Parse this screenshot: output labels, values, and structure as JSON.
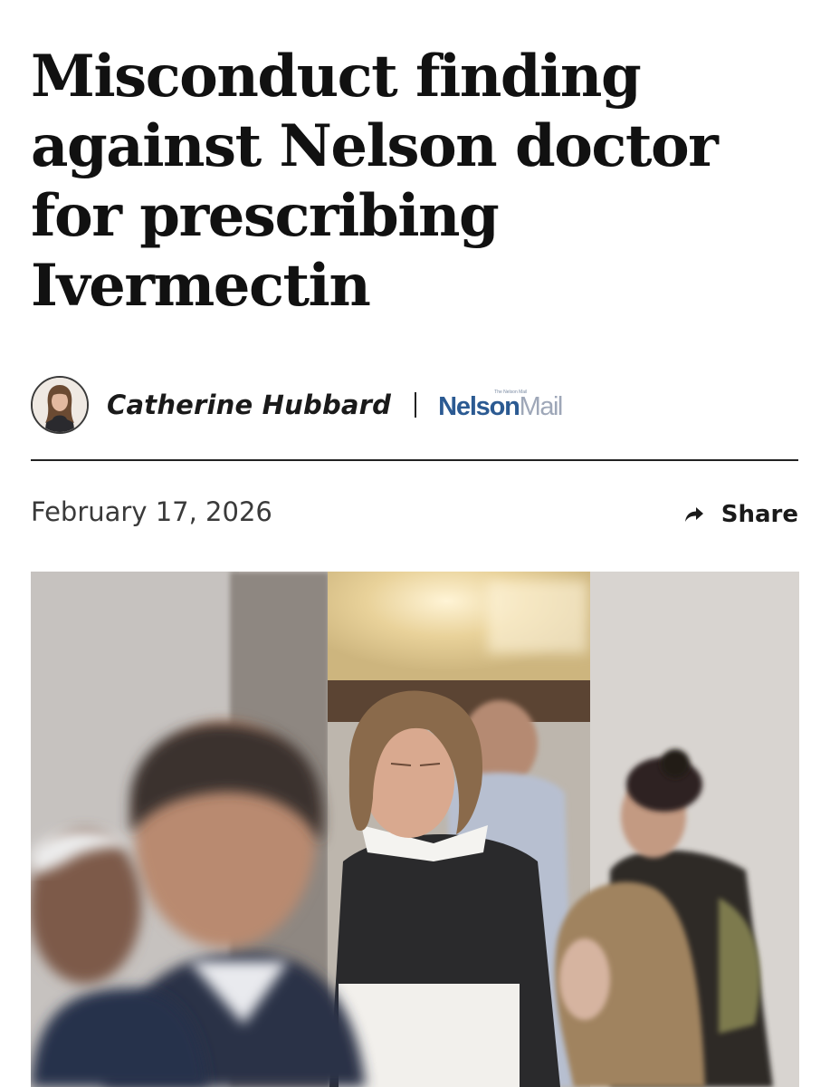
{
  "article": {
    "headline_lines": [
      "Misconduct finding",
      "against Nelson doctor",
      "for prescribing",
      "Ivermectin"
    ],
    "author": "Catherine Hubbard",
    "publication": {
      "part1": "Nelson",
      "part2": "Mail",
      "tag": "The Nelson Mail"
    },
    "date": "February 17, 2026",
    "share_label": "Share"
  },
  "icons": {
    "share": "share-arrow-icon",
    "avatar": "author-avatar"
  },
  "colors": {
    "text": "#111111",
    "brand_primary": "#2b5a92",
    "brand_secondary": "#9ea7b8"
  }
}
